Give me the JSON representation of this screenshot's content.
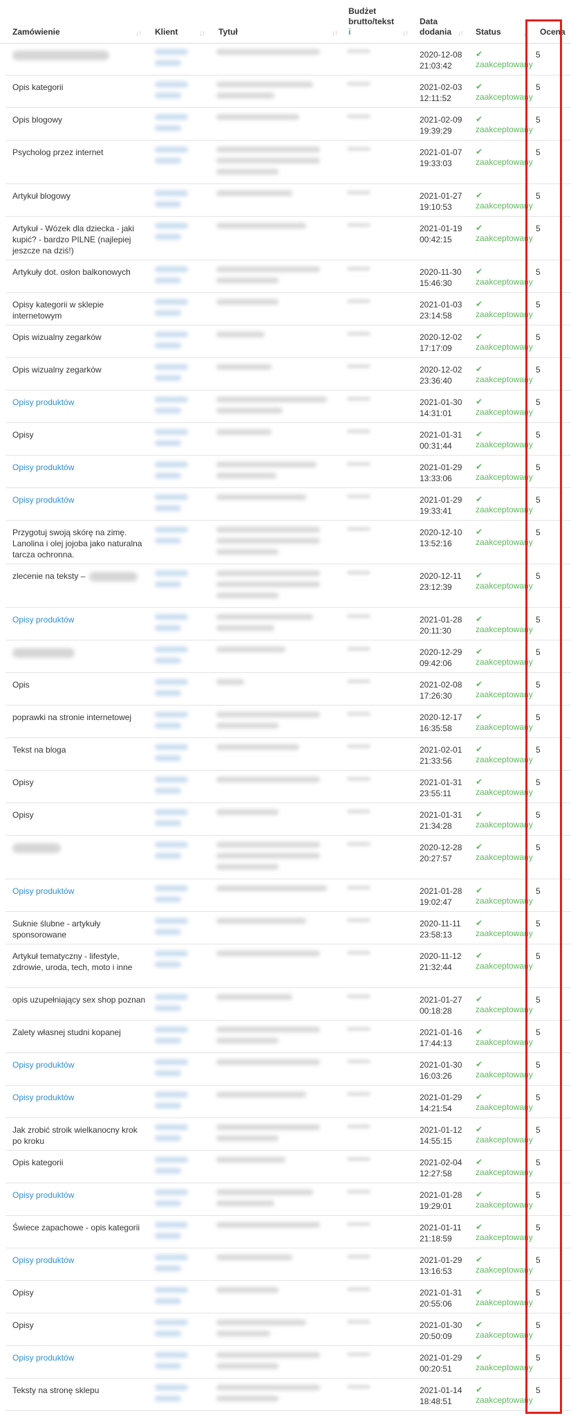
{
  "table": {
    "headers": {
      "order": "Zamówienie",
      "client": "Klient",
      "title": "Tytuł",
      "budget_l1": "Budżet",
      "budget_l2": "brutto/tekst",
      "budget_info": "i",
      "date_l1": "Data",
      "date_l2": "dodania",
      "status": "Status",
      "score": "Ocena"
    },
    "sort_glyph": "↓↑",
    "status_check": "✔",
    "rows": [
      {
        "order": "",
        "order_blurred": true,
        "link": false,
        "date1": "2020-12-08",
        "date2": "21:03:42",
        "status": "zaakceptowany",
        "score": "5"
      },
      {
        "order": "Opis kategorii",
        "link": false,
        "date1": "2021-02-03",
        "date2": "12:11:52",
        "status": "zaakceptowany",
        "score": "5"
      },
      {
        "order": "Opis blogowy",
        "link": false,
        "date1": "2021-02-09",
        "date2": "19:39:29",
        "status": "zaakceptowany",
        "score": "5"
      },
      {
        "order": "Psycholog przez internet",
        "link": false,
        "date1": "2021-01-07",
        "date2": "19:33:03",
        "status": "zaakceptowany",
        "score": "5"
      },
      {
        "order": "Artykuł blogowy",
        "link": false,
        "date1": "2021-01-27",
        "date2": "19:10:53",
        "status": "zaakceptowany",
        "score": "5"
      },
      {
        "order": "Artykuł - Wózek dla dziecka - jaki kupić? - bardzo PILNE (najlepiej jeszcze na dziś!)",
        "link": false,
        "date1": "2021-01-19",
        "date2": "00:42:15",
        "status": "zaakceptowany",
        "score": "5"
      },
      {
        "order": "Artykuły dot. osłon balkonowych",
        "link": false,
        "date1": "2020-11-30",
        "date2": "15:46:30",
        "status": "zaakceptowany",
        "score": "5"
      },
      {
        "order": "Opisy kategorii w sklepie internetowym",
        "link": false,
        "date1": "2021-01-03",
        "date2": "23:14:58",
        "status": "zaakceptowany",
        "score": "5"
      },
      {
        "order": "Opis wizualny zegarków",
        "link": false,
        "date1": "2020-12-02",
        "date2": "17:17:09",
        "status": "zaakceptowany",
        "score": "5"
      },
      {
        "order": "Opis wizualny zegarków",
        "link": false,
        "date1": "2020-12-02",
        "date2": "23:36:40",
        "status": "zaakceptowany",
        "score": "5"
      },
      {
        "order": "Opisy produktów",
        "link": true,
        "date1": "2021-01-30",
        "date2": "14:31:01",
        "status": "zaakceptowany",
        "score": "5"
      },
      {
        "order": "Opisy",
        "link": false,
        "date1": "2021-01-31",
        "date2": "00:31:44",
        "status": "zaakceptowany",
        "score": "5"
      },
      {
        "order": "Opisy produktów",
        "link": true,
        "date1": "2021-01-29",
        "date2": "13:33:06",
        "status": "zaakceptowany",
        "score": "5"
      },
      {
        "order": "Opisy produktów",
        "link": true,
        "date1": "2021-01-29",
        "date2": "19:33:41",
        "status": "zaakceptowany",
        "score": "5"
      },
      {
        "order": "Przygotuj swoją skórę na zimę. Lanolina i olej jojoba jako naturalna tarcza ochronna.",
        "link": false,
        "date1": "2020-12-10",
        "date2": "13:52:16",
        "status": "zaakceptowany",
        "score": "5"
      },
      {
        "order": "zlecenie na teksty –",
        "order_blurred_tail": true,
        "link": false,
        "date1": "2020-12-11",
        "date2": "23:12:39",
        "status": "zaakceptowany",
        "score": "5"
      },
      {
        "order": "Opisy produktów",
        "link": true,
        "date1": "2021-01-28",
        "date2": "20:11:30",
        "status": "zaakceptowany",
        "score": "5"
      },
      {
        "order": "",
        "order_blurred": true,
        "link": false,
        "date1": "2020-12-29",
        "date2": "09:42:06",
        "status": "zaakceptowany",
        "score": "5"
      },
      {
        "order": "Opis",
        "link": false,
        "date1": "2021-02-08",
        "date2": "17:26:30",
        "status": "zaakceptowany",
        "score": "5"
      },
      {
        "order": "poprawki na stronie internetowej",
        "link": false,
        "date1": "2020-12-17",
        "date2": "16:35:58",
        "status": "zaakceptowany",
        "score": "5"
      },
      {
        "order": "Tekst na bloga",
        "link": false,
        "date1": "2021-02-01",
        "date2": "21:33:56",
        "status": "zaakceptowany",
        "score": "5"
      },
      {
        "order": "Opisy",
        "link": false,
        "date1": "2021-01-31",
        "date2": "23:55:11",
        "status": "zaakceptowany",
        "score": "5"
      },
      {
        "order": "Opisy",
        "link": false,
        "date1": "2021-01-31",
        "date2": "21:34:28",
        "status": "zaakceptowany",
        "score": "5"
      },
      {
        "order": "",
        "order_blurred": true,
        "link": false,
        "date1": "2020-12-28",
        "date2": "20:27:57",
        "status": "zaakceptowany",
        "score": "5"
      },
      {
        "order": "Opisy produktów",
        "link": true,
        "date1": "2021-01-28",
        "date2": "19:02:47",
        "status": "zaakceptowany",
        "score": "5"
      },
      {
        "order": "Suknie ślubne - artykuły sponsorowane",
        "link": false,
        "date1": "2020-11-11",
        "date2": "23:58:13",
        "status": "zaakceptowany",
        "score": "5"
      },
      {
        "order": "Artykuł tematyczny - lifestyle, zdrowie, uroda, tech, moto i inne",
        "link": false,
        "date1": "2020-11-12",
        "date2": "21:32:44",
        "status": "zaakceptowany",
        "score": "5"
      },
      {
        "order": "opis uzupełniający sex shop poznan",
        "link": false,
        "date1": "2021-01-27",
        "date2": "00:18:28",
        "status": "zaakceptowany",
        "score": "5"
      },
      {
        "order": "Zalety własnej studni kopanej",
        "link": false,
        "date1": "2021-01-16",
        "date2": "17:44:13",
        "status": "zaakceptowany",
        "score": "5"
      },
      {
        "order": "Opisy produktów",
        "link": true,
        "date1": "2021-01-30",
        "date2": "16:03:26",
        "status": "zaakceptowany",
        "score": "5"
      },
      {
        "order": "Opisy produktów",
        "link": true,
        "date1": "2021-01-29",
        "date2": "14:21:54",
        "status": "zaakceptowany",
        "score": "5"
      },
      {
        "order": "Jak zrobić stroik wielkanocny krok po kroku",
        "link": false,
        "date1": "2021-01-12",
        "date2": "14:55:15",
        "status": "zaakceptowany",
        "score": "5"
      },
      {
        "order": "Opis kategorii",
        "link": false,
        "date1": "2021-02-04",
        "date2": "12:27:58",
        "status": "zaakceptowany",
        "score": "5"
      },
      {
        "order": "Opisy produktów",
        "link": true,
        "date1": "2021-01-28",
        "date2": "19:29:01",
        "status": "zaakceptowany",
        "score": "5"
      },
      {
        "order": "Świece zapachowe - opis kategorii",
        "link": false,
        "date1": "2021-01-11",
        "date2": "21:18:59",
        "status": "zaakceptowany",
        "score": "5"
      },
      {
        "order": "Opisy produktów",
        "link": true,
        "date1": "2021-01-29",
        "date2": "13:16:53",
        "status": "zaakceptowany",
        "score": "5"
      },
      {
        "order": "Opisy",
        "link": false,
        "date1": "2021-01-31",
        "date2": "20:55:06",
        "status": "zaakceptowany",
        "score": "5"
      },
      {
        "order": "Opisy",
        "link": false,
        "date1": "2021-01-30",
        "date2": "20:50:09",
        "status": "zaakceptowany",
        "score": "5"
      },
      {
        "order": "Opisy produktów",
        "link": true,
        "date1": "2021-01-29",
        "date2": "00:20:51",
        "status": "zaakceptowany",
        "score": "5"
      },
      {
        "order": "Teksty na stronę sklepu",
        "link": false,
        "date1": "2021-01-14",
        "date2": "18:48:51",
        "status": "zaakceptowany",
        "score": "5"
      }
    ]
  },
  "colors": {
    "link": "#2e8fd6",
    "status_ok": "#5cb85c",
    "highlight": "#e1201c"
  }
}
